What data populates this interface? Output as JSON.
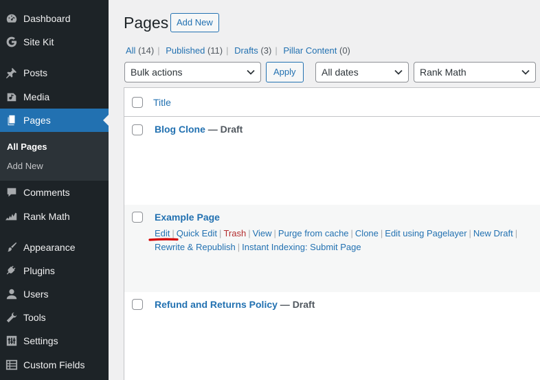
{
  "sidebar": {
    "items": [
      {
        "label": "Dashboard",
        "icon": "dashboard-icon"
      },
      {
        "label": "Site Kit",
        "icon": "google-g-icon"
      },
      {
        "label": "Posts",
        "icon": "pushpin-icon"
      },
      {
        "label": "Media",
        "icon": "media-icon"
      },
      {
        "label": "Pages",
        "icon": "pages-icon"
      },
      {
        "label": "Comments",
        "icon": "comment-icon"
      },
      {
        "label": "Rank Math",
        "icon": "rank-math-icon"
      },
      {
        "label": "Appearance",
        "icon": "paintbrush-icon"
      },
      {
        "label": "Plugins",
        "icon": "plug-icon"
      },
      {
        "label": "Users",
        "icon": "user-icon"
      },
      {
        "label": "Tools",
        "icon": "wrench-icon"
      },
      {
        "label": "Settings",
        "icon": "settings-sliders-icon"
      },
      {
        "label": "Custom Fields",
        "icon": "table-icon"
      }
    ],
    "submenu": [
      "All Pages",
      "Add New"
    ]
  },
  "header": {
    "title": "Pages",
    "add_new": "Add New"
  },
  "filters": {
    "all": "All",
    "all_count": "(14)",
    "published": "Published",
    "published_count": "(11)",
    "drafts": "Drafts",
    "drafts_count": "(3)",
    "pillar": "Pillar Content",
    "pillar_count": "(0)",
    "separator": "|"
  },
  "toolbar": {
    "bulk_actions": "Bulk actions",
    "apply": "Apply",
    "dates": "All dates",
    "rank_math": "Rank Math"
  },
  "table": {
    "column_title": "Title",
    "rows": [
      {
        "title": "Blog Clone",
        "state": " — Draft"
      },
      {
        "title": "Example Page",
        "state": ""
      },
      {
        "title": "Refund and Returns Policy",
        "state": " — Draft"
      }
    ],
    "actions": [
      "Edit",
      "Quick Edit",
      "Trash",
      "View",
      "Purge from cache",
      "Clone",
      "Edit using Pagelayer",
      "New Draft",
      "Rewrite & Republish",
      "Instant Indexing: Submit Page"
    ],
    "action_separator": "|"
  },
  "colors": {
    "sidebar": "#1d2327",
    "active": "#2271b1",
    "link": "#2271b1",
    "trash": "#b32d2e",
    "annotation": "#d40000"
  }
}
